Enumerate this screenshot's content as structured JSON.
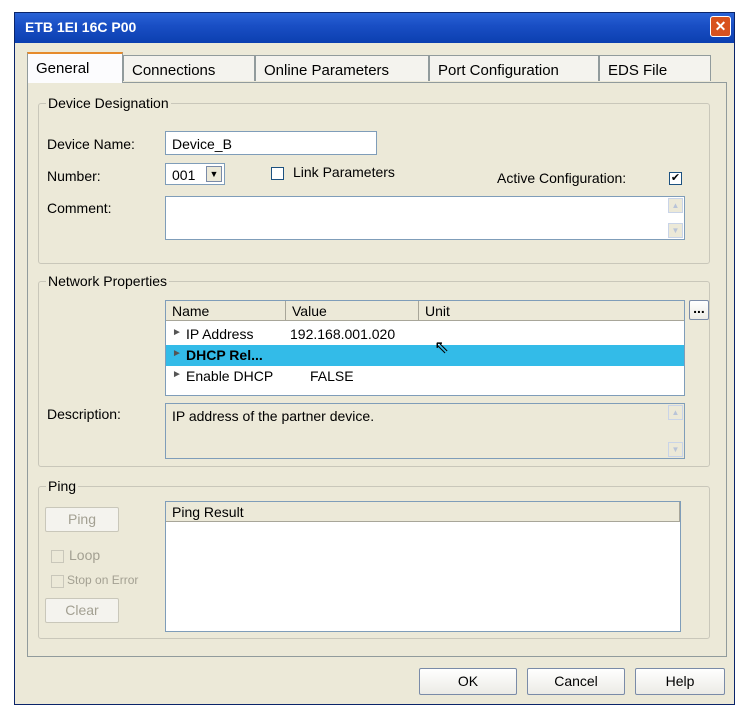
{
  "window": {
    "title": "ETB 1EI 16C P00",
    "close_symbol": "✕"
  },
  "tabs": [
    {
      "label": "General",
      "active": true
    },
    {
      "label": "Connections"
    },
    {
      "label": "Online Parameters"
    },
    {
      "label": "Port Configuration"
    },
    {
      "label": "EDS File"
    }
  ],
  "designation": {
    "legend": "Device Designation",
    "device_name_label": "Device Name:",
    "device_name_value": "Device_B",
    "number_label": "Number:",
    "number_value": "001",
    "link_params_label": "Link Parameters",
    "link_params_checked": false,
    "active_config_label": "Active Configuration:",
    "active_config_check": "✔",
    "comment_label": "Comment:",
    "comment_value": ""
  },
  "network": {
    "legend": "Network Properties",
    "columns": [
      "Name",
      "Value",
      "Unit"
    ],
    "ellipsis_label": "...",
    "rows": [
      {
        "name": "IP Address",
        "value": "192.168.001.020",
        "unit": ""
      },
      {
        "name": "DHCP Rel...",
        "value": "",
        "unit": "",
        "selected": true
      },
      {
        "name": "Enable DHCP",
        "value": "FALSE",
        "unit": ""
      }
    ],
    "description_label": "Description:",
    "description_value": "IP address of the partner device."
  },
  "ping": {
    "legend": "Ping",
    "ping_button": "Ping",
    "loop_label": "Loop",
    "stop_on_error_label": "Stop on Error",
    "clear_button": "Clear",
    "result_header": "Ping Result"
  },
  "footer": {
    "ok": "OK",
    "cancel": "Cancel",
    "help": "Help"
  },
  "colors": {
    "title_bar": "#1a4fc5",
    "selected_row": "#33bbe8",
    "close_button": "#d8521e"
  }
}
